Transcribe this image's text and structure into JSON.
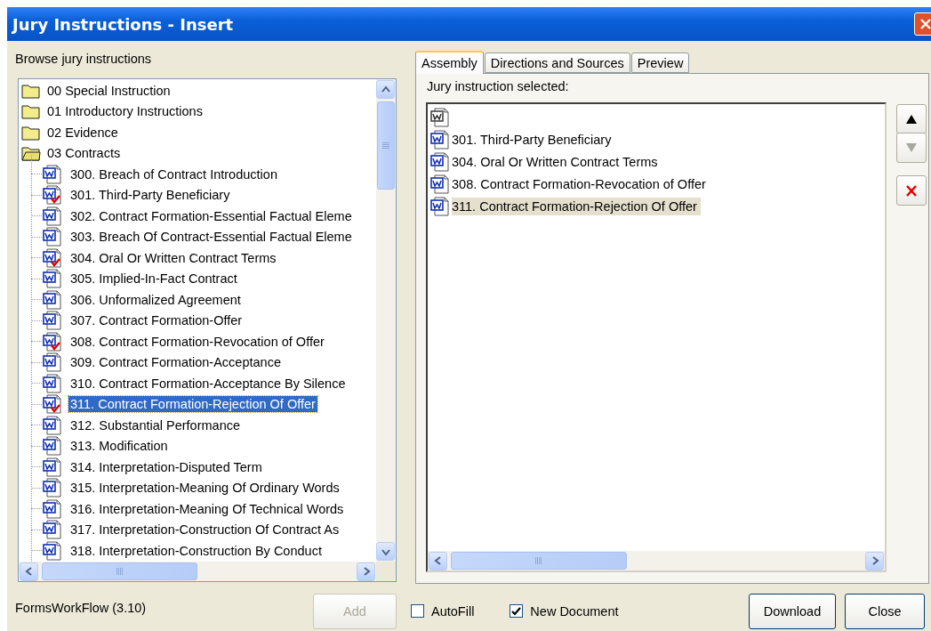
{
  "window": {
    "title": "Jury Instructions - Insert"
  },
  "browser": {
    "label": "Browse jury instructions",
    "tree": [
      {
        "label": "00 Special Instruction",
        "expanded": false
      },
      {
        "label": "01 Introductory Instructions",
        "expanded": false
      },
      {
        "label": "02 Evidence",
        "expanded": false
      },
      {
        "label": "03 Contracts",
        "expanded": true,
        "children": [
          {
            "label": "300. Breach of Contract Introduction",
            "checked": false,
            "selected": false
          },
          {
            "label": "301. Third-Party Beneficiary",
            "checked": true,
            "selected": false
          },
          {
            "label": "302. Contract Formation-Essential Factual Eleme",
            "checked": false,
            "selected": false
          },
          {
            "label": "303. Breach Of Contract-Essential Factual Eleme",
            "checked": false,
            "selected": false
          },
          {
            "label": "304. Oral Or Written Contract Terms",
            "checked": true,
            "selected": false
          },
          {
            "label": "305. Implied-In-Fact Contract",
            "checked": false,
            "selected": false
          },
          {
            "label": "306. Unformalized Agreement",
            "checked": false,
            "selected": false
          },
          {
            "label": "307. Contract Formation-Offer",
            "checked": false,
            "selected": false
          },
          {
            "label": "308. Contract Formation-Revocation of Offer",
            "checked": true,
            "selected": false
          },
          {
            "label": "309. Contract Formation-Acceptance",
            "checked": false,
            "selected": false
          },
          {
            "label": "310. Contract Formation-Acceptance By Silence",
            "checked": false,
            "selected": false
          },
          {
            "label": "311. Contract Formation-Rejection Of Offer",
            "checked": true,
            "selected": true
          },
          {
            "label": "312. Substantial Performance",
            "checked": false,
            "selected": false
          },
          {
            "label": "313. Modification",
            "checked": false,
            "selected": false
          },
          {
            "label": "314. Interpretation-Disputed Term",
            "checked": false,
            "selected": false
          },
          {
            "label": "315. Interpretation-Meaning Of Ordinary Words",
            "checked": false,
            "selected": false
          },
          {
            "label": "316. Interpretation-Meaning Of Technical Words",
            "checked": false,
            "selected": false
          },
          {
            "label": "317. Interpretation-Construction Of Contract As",
            "checked": false,
            "selected": false
          },
          {
            "label": "318. Interpretation-Construction By Conduct",
            "checked": false,
            "selected": false
          }
        ]
      }
    ]
  },
  "tabs": [
    {
      "label": "Assembly",
      "selected": true
    },
    {
      "label": "Directions and Sources",
      "selected": false
    },
    {
      "label": "Preview",
      "selected": false
    }
  ],
  "assembly": {
    "label": "Jury instruction selected:",
    "items": [
      {
        "kind": "blank",
        "selected": false
      },
      {
        "kind": "document",
        "label": "301. Third-Party Beneficiary",
        "selected": false
      },
      {
        "kind": "document",
        "label": "304. Oral Or Written Contract Terms",
        "selected": false
      },
      {
        "kind": "document",
        "label": "308. Contract Formation-Revocation of Offer",
        "selected": false
      },
      {
        "kind": "document",
        "label": "311. Contract Formation-Rejection Of Offer",
        "selected": true
      }
    ]
  },
  "side_buttons": [
    {
      "kind": "up",
      "disabled": false
    },
    {
      "kind": "down",
      "disabled": true
    },
    {
      "kind": "remove",
      "disabled": false
    }
  ],
  "status": "FormsWorkFlow (3.10)",
  "add_button": {
    "label": "Add",
    "disabled": true
  },
  "options": [
    {
      "label": "AutoFill",
      "checked": false
    },
    {
      "label": "New Document",
      "checked": true
    }
  ],
  "buttons": [
    {
      "label": "Download"
    },
    {
      "label": "Close"
    }
  ]
}
